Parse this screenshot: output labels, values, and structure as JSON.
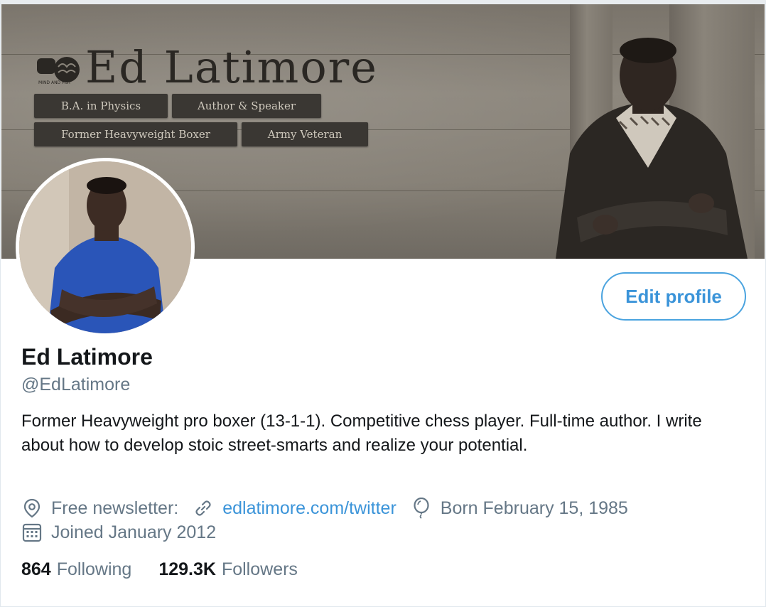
{
  "banner": {
    "title": "Ed Latimore",
    "logo_text": "MIND AND FIST",
    "tags": [
      "B.A. in Physics",
      "Author & Speaker",
      "Former Heavyweight Boxer",
      "Army Veteran"
    ]
  },
  "profile": {
    "display_name": "Ed Latimore",
    "handle": "@EdLatimore",
    "bio": "Former Heavyweight pro boxer (13-1-1). Competitive chess player. Full-time author. I write about how to develop stoic street-smarts and realize your potential.",
    "location": "Free newsletter:",
    "website": "edlatimore.com/twitter",
    "birthday": "Born February 15, 1985",
    "joined": "Joined January 2012"
  },
  "actions": {
    "edit_profile_label": "Edit profile"
  },
  "stats": {
    "following_count": "864",
    "following_label": "Following",
    "followers_count": "129.3K",
    "followers_label": "Followers"
  },
  "icons": {
    "location": "location-pin-icon",
    "link": "link-icon",
    "birthday": "balloon-icon",
    "joined": "calendar-icon"
  },
  "colors": {
    "accent": "#3b94d9",
    "text": "#14171a",
    "secondary": "#657786"
  }
}
